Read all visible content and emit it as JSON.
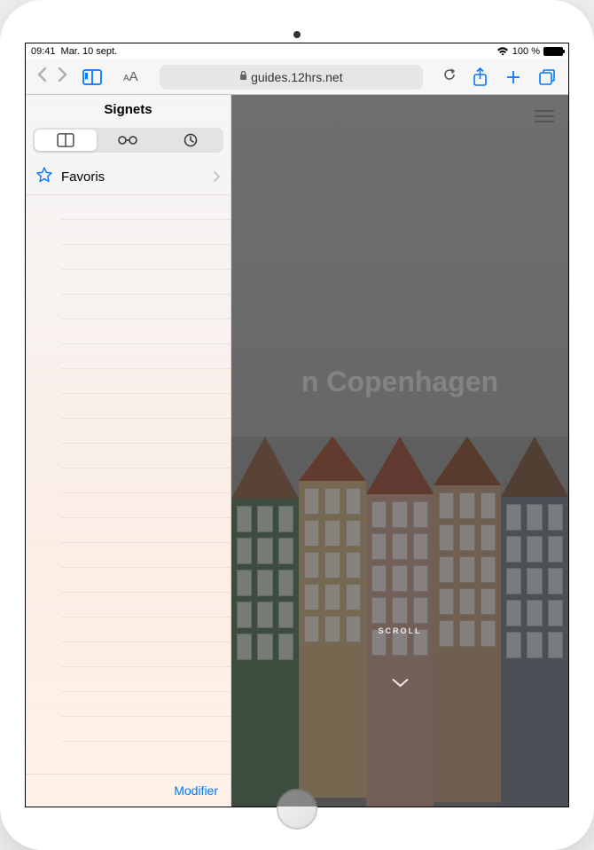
{
  "statusBar": {
    "time": "09:41",
    "date": "Mar. 10 sept.",
    "battery": "100 %"
  },
  "toolbar": {
    "textSize": "AA",
    "url": "guides.12hrs.net"
  },
  "sidebar": {
    "title": "Signets",
    "items": [
      {
        "label": "Favoris"
      }
    ],
    "editLabel": "Modifier"
  },
  "page": {
    "headline": "n Copenhagen",
    "scrollLabel": "SCROLL"
  }
}
